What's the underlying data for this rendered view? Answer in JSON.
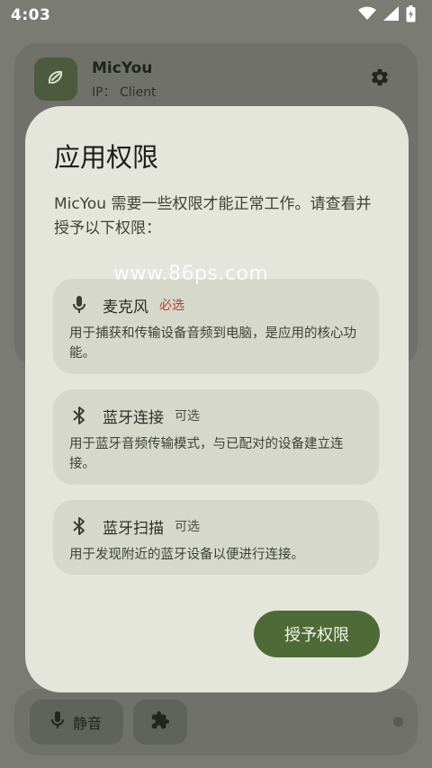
{
  "status_bar": {
    "time": "4:03",
    "icons": [
      "wifi-icon",
      "signal-icon",
      "battery-icon"
    ]
  },
  "app": {
    "name": "MicYou",
    "ip_label": "IP： Client",
    "icons": [
      "app-logo-icon",
      "gear-icon"
    ]
  },
  "bottom_bar": {
    "mute_label": "静音",
    "icons": [
      "mic-icon",
      "puzzle-icon"
    ]
  },
  "dialog": {
    "title": "应用权限",
    "message": "MicYou 需要一些权限才能正常工作。请查看并授予以下权限：",
    "permissions": [
      {
        "icon": "mic-icon",
        "name": "麦克风",
        "badge": "必选",
        "badge_color": "#b3402a",
        "description": "用于捕获和传输设备音频到电脑，是应用的核心功能。"
      },
      {
        "icon": "bluetooth-icon",
        "name": "蓝牙连接",
        "badge": "可选",
        "badge_color": "#4a4e44",
        "description": "用于蓝牙音频传输模式，与已配对的设备建立连接。"
      },
      {
        "icon": "bluetooth-icon",
        "name": "蓝牙扫描",
        "badge": "可选",
        "badge_color": "#4a4e44",
        "description": "用于发现附近的蓝牙设备以便进行连接。"
      }
    ],
    "grant_button": "授予权限"
  },
  "watermark": "www.86ps.com",
  "colors": {
    "accent": "#4e6a37",
    "dialog_bg": "#e4e5db",
    "card_bg": "#d6d8cc",
    "required": "#b3402a"
  }
}
